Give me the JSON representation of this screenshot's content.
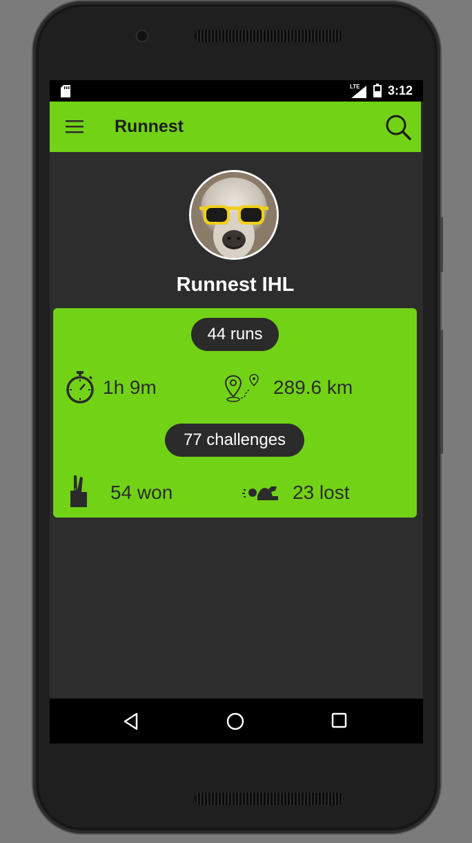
{
  "status_bar": {
    "network": "LTE",
    "time": "3:12"
  },
  "app_bar": {
    "title": "Runnest",
    "menu_icon": "hamburger-menu-icon",
    "search_icon": "search-icon"
  },
  "profile": {
    "name": "Runnest IHL",
    "avatar": "alpaca-with-yellow-sunglasses"
  },
  "stats": {
    "runs": "44 runs",
    "duration": "1h 9m",
    "distance": "289.6 km",
    "challenges": "77 challenges",
    "won": "54 won",
    "lost": "23 lost"
  },
  "colors": {
    "accent": "#72d316",
    "background": "#2d2d2d",
    "pill": "#2b2b2b"
  },
  "nav_bar": {
    "icons": [
      "back-triangle-icon",
      "home-circle-icon",
      "recents-square-icon"
    ]
  }
}
